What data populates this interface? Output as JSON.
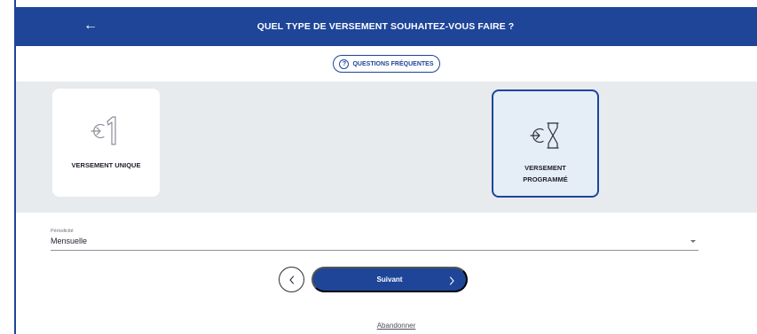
{
  "header": {
    "title": "QUEL TYPE DE VERSEMENT SOUHAITEZ-VOUS FAIRE ?",
    "back_glyph": "←",
    "background_color": "#1e4598"
  },
  "faq": {
    "label": "QUESTIONS FRÉQUENTES",
    "icon": "question-circle-icon",
    "icon_glyph": "?"
  },
  "options": [
    {
      "label": "VERSEMENT UNIQUE",
      "icon": "one-time-payment-icon",
      "selected": false
    },
    {
      "label": "VERSEMENT PROGRAMMÉ",
      "icon": "scheduled-payment-icon",
      "selected": true
    }
  ],
  "periodicity": {
    "label": "Périodicité",
    "value": "Mensuelle"
  },
  "navigation": {
    "next_label": "Suivant",
    "previous_icon": "chevron-left-icon",
    "next_icon": "chevron-right-icon"
  },
  "abandon_label": "Abandonner",
  "colors": {
    "primary": "#1e4598",
    "band": "#e7ebee",
    "selected_card": "#e5edf7"
  }
}
